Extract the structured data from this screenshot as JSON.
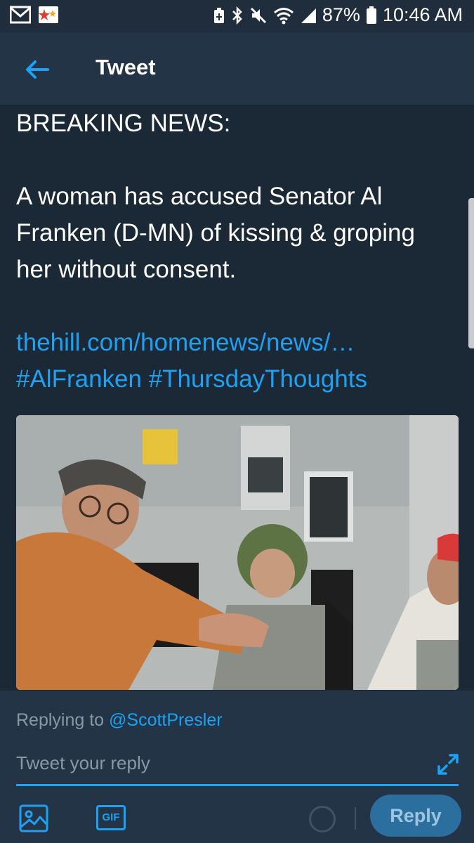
{
  "status_bar": {
    "battery": "87%",
    "time": "10:46 AM"
  },
  "header": {
    "title": "Tweet"
  },
  "tweet": {
    "text": "BREAKING NEWS:\n\nA woman has accused Senator Al Franken (D-MN) of kissing & groping her without consent.",
    "link": "thehill.com/homenews/news/…",
    "hashtags": "#AlFranken #ThursdayThoughts"
  },
  "composer": {
    "replying_prefix": "Replying to ",
    "replying_handle": "@ScottPresler",
    "placeholder": "Tweet your reply",
    "gif_label": "GIF",
    "reply_label": "Reply"
  },
  "colors": {
    "accent": "#1da1f2",
    "background": "#1b2836",
    "header": "#243447",
    "muted": "#8899a6"
  }
}
